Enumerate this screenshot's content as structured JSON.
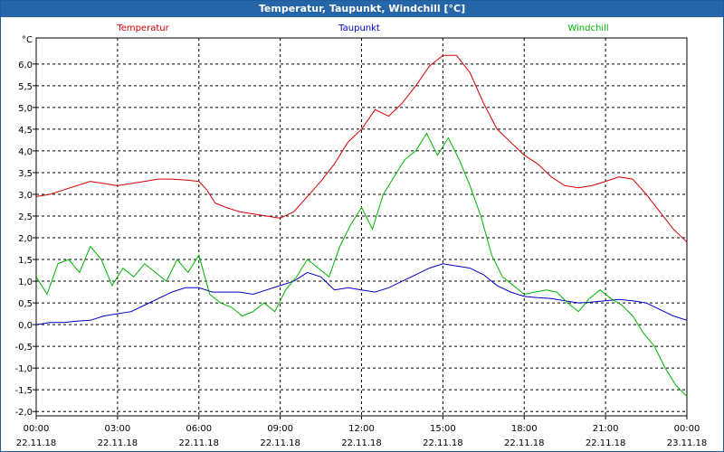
{
  "window": {
    "title": "Temperatur, Taupunkt, Windchill [°C]"
  },
  "colors": {
    "temperatur": "#d40000",
    "taupunkt": "#0000c8",
    "windchill": "#00b400",
    "grid": "#000000"
  },
  "chart_data": {
    "type": "line",
    "title": "Temperatur, Taupunkt, Windchill [°C]",
    "ylabel": "°C",
    "ylim": [
      -2.1,
      6.6
    ],
    "grid": true,
    "legend_placement": "top",
    "y_ticks": [
      "6,0",
      "5,5",
      "5,0",
      "4,5",
      "4,0",
      "3,5",
      "3,0",
      "2,5",
      "2,0",
      "1,5",
      "1,0",
      "0,5",
      "0,0",
      "-0,5",
      "-1,0",
      "-1,5",
      "-2,0"
    ],
    "y_tick_values": [
      6.0,
      5.5,
      5.0,
      4.5,
      4.0,
      3.5,
      3.0,
      2.5,
      2.0,
      1.5,
      1.0,
      0.5,
      0.0,
      -0.5,
      -1.0,
      -1.5,
      -2.0
    ],
    "x_ticks": [
      {
        "h": 0,
        "time": "00:00",
        "date": "22.11.18"
      },
      {
        "h": 3,
        "time": "03:00",
        "date": "22.11.18"
      },
      {
        "h": 6,
        "time": "06:00",
        "date": "22.11.18"
      },
      {
        "h": 9,
        "time": "09:00",
        "date": "22.11.18"
      },
      {
        "h": 12,
        "time": "12:00",
        "date": "22.11.18"
      },
      {
        "h": 15,
        "time": "15:00",
        "date": "22.11.18"
      },
      {
        "h": 18,
        "time": "18:00",
        "date": "22.11.18"
      },
      {
        "h": 21,
        "time": "21:00",
        "date": "22.11.18"
      },
      {
        "h": 24,
        "time": "00:00",
        "date": "23.11.18"
      }
    ],
    "series": [
      {
        "name": "Temperatur",
        "x": [
          0,
          0.5,
          1,
          1.5,
          2,
          2.5,
          3,
          3.5,
          4,
          4.5,
          5,
          5.5,
          6,
          6.3,
          6.6,
          7,
          7.5,
          8,
          8.5,
          9,
          9.5,
          10,
          10.5,
          11,
          11.5,
          12,
          12.5,
          13,
          13.5,
          14,
          14.5,
          15,
          15.5,
          16,
          16.5,
          17,
          17.5,
          18,
          18.5,
          19,
          19.5,
          20,
          20.5,
          21,
          21.5,
          22,
          22.5,
          23,
          23.5,
          24
        ],
        "values": [
          2.95,
          3.0,
          3.1,
          3.2,
          3.3,
          3.25,
          3.2,
          3.25,
          3.3,
          3.35,
          3.35,
          3.33,
          3.3,
          3.1,
          2.8,
          2.7,
          2.6,
          2.55,
          2.5,
          2.45,
          2.6,
          2.95,
          3.3,
          3.7,
          4.2,
          4.5,
          4.95,
          4.8,
          5.1,
          5.5,
          5.95,
          6.2,
          6.2,
          5.8,
          5.1,
          4.5,
          4.2,
          3.9,
          3.7,
          3.4,
          3.2,
          3.15,
          3.2,
          3.3,
          3.4,
          3.35,
          3.0,
          2.6,
          2.2,
          1.9
        ]
      },
      {
        "name": "Taupunkt",
        "x": [
          0,
          0.5,
          1,
          1.5,
          2,
          2.5,
          3,
          3.5,
          4,
          4.5,
          5,
          5.5,
          6,
          6.5,
          7,
          7.5,
          8,
          8.5,
          9,
          9.5,
          10,
          10.5,
          11,
          11.5,
          12,
          12.5,
          13,
          13.5,
          14,
          14.5,
          15,
          15.5,
          16,
          16.5,
          17,
          17.5,
          18,
          18.5,
          19,
          19.5,
          20,
          20.5,
          21,
          21.5,
          22,
          22.5,
          23,
          23.5,
          24
        ],
        "values": [
          0.0,
          0.05,
          0.05,
          0.08,
          0.1,
          0.2,
          0.25,
          0.3,
          0.45,
          0.6,
          0.75,
          0.85,
          0.85,
          0.75,
          0.75,
          0.75,
          0.7,
          0.8,
          0.9,
          1.0,
          1.2,
          1.1,
          0.8,
          0.85,
          0.8,
          0.75,
          0.85,
          1.0,
          1.15,
          1.3,
          1.4,
          1.35,
          1.3,
          1.15,
          0.9,
          0.75,
          0.65,
          0.62,
          0.6,
          0.55,
          0.5,
          0.52,
          0.55,
          0.58,
          0.55,
          0.5,
          0.35,
          0.2,
          0.1
        ]
      },
      {
        "name": "Windchill",
        "x": [
          0,
          0.4,
          0.8,
          1.2,
          1.6,
          2,
          2.4,
          2.8,
          3.2,
          3.6,
          4,
          4.4,
          4.8,
          5.2,
          5.6,
          6,
          6.4,
          6.8,
          7.2,
          7.6,
          8,
          8.4,
          8.8,
          9.2,
          9.6,
          10,
          10.4,
          10.8,
          11.2,
          11.6,
          12,
          12.4,
          12.8,
          13.2,
          13.6,
          14,
          14.4,
          14.8,
          15.2,
          15.6,
          16,
          16.4,
          16.8,
          17.2,
          17.6,
          18,
          18.4,
          18.8,
          19.2,
          19.6,
          20,
          20.4,
          20.8,
          21.2,
          21.6,
          22,
          22.4,
          22.8,
          23.2,
          23.6,
          24
        ],
        "values": [
          1.1,
          0.7,
          1.4,
          1.5,
          1.2,
          1.8,
          1.5,
          0.9,
          1.3,
          1.1,
          1.4,
          1.2,
          1.0,
          1.5,
          1.2,
          1.6,
          0.7,
          0.5,
          0.4,
          0.2,
          0.3,
          0.5,
          0.3,
          0.8,
          1.1,
          1.5,
          1.3,
          1.1,
          1.8,
          2.3,
          2.7,
          2.2,
          3.0,
          3.4,
          3.8,
          4.0,
          4.4,
          3.9,
          4.3,
          3.8,
          3.2,
          2.5,
          1.6,
          1.1,
          0.9,
          0.7,
          0.75,
          0.8,
          0.75,
          0.5,
          0.3,
          0.6,
          0.8,
          0.6,
          0.45,
          0.2,
          -0.2,
          -0.5,
          -1.0,
          -1.4,
          -1.65
        ]
      }
    ]
  }
}
